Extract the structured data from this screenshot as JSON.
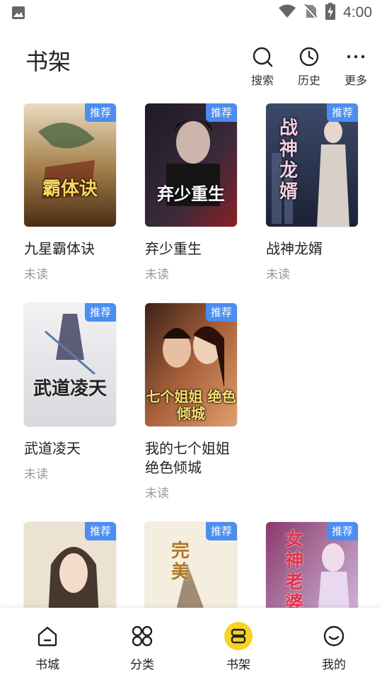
{
  "status_bar": {
    "time": "4:00"
  },
  "header": {
    "title": "书架",
    "actions": [
      {
        "label": "搜索",
        "icon": "search-icon"
      },
      {
        "label": "历史",
        "icon": "clock-icon"
      },
      {
        "label": "更多",
        "icon": "more-icon"
      }
    ]
  },
  "badge_text": "推荐",
  "books": [
    {
      "title": "九星霸体诀",
      "status": "未读",
      "cover_text": "霸体诀",
      "colors": [
        "#d9c7a6",
        "#5a3a1e"
      ]
    },
    {
      "title": "弃少重生",
      "status": "未读",
      "cover_text": "弃少重生",
      "colors": [
        "#2a2430",
        "#8a1f25"
      ]
    },
    {
      "title": "战神龙婿",
      "status": "未读",
      "cover_text": "战神龙婿",
      "colors": [
        "#2c3650",
        "#6c7690"
      ]
    },
    {
      "title": "武道凌天",
      "status": "未读",
      "cover_text": "武道凌天",
      "colors": [
        "#e8e8ec",
        "#3a3a48"
      ]
    },
    {
      "title": "我的七个姐姐绝色倾城",
      "status": "未读",
      "cover_text": "七个姐姐 绝色倾城",
      "colors": [
        "#6b3a2a",
        "#c87a50"
      ]
    },
    {
      "title": "",
      "status": "",
      "cover_text": "",
      "colors": [
        "#e9dcc8",
        "#c9a48a"
      ]
    },
    {
      "title": "",
      "status": "",
      "cover_text": "完美",
      "colors": [
        "#f3ecdc",
        "#c9a050"
      ]
    },
    {
      "title": "",
      "status": "",
      "cover_text": "女神老婆",
      "colors": [
        "#c8b6de",
        "#6a3a6a"
      ]
    }
  ],
  "bottom_nav": [
    {
      "label": "书城",
      "icon": "home-icon"
    },
    {
      "label": "分类",
      "icon": "grid-icon"
    },
    {
      "label": "书架",
      "icon": "bookshelf-icon",
      "active": true
    },
    {
      "label": "我的",
      "icon": "smiley-icon"
    }
  ]
}
